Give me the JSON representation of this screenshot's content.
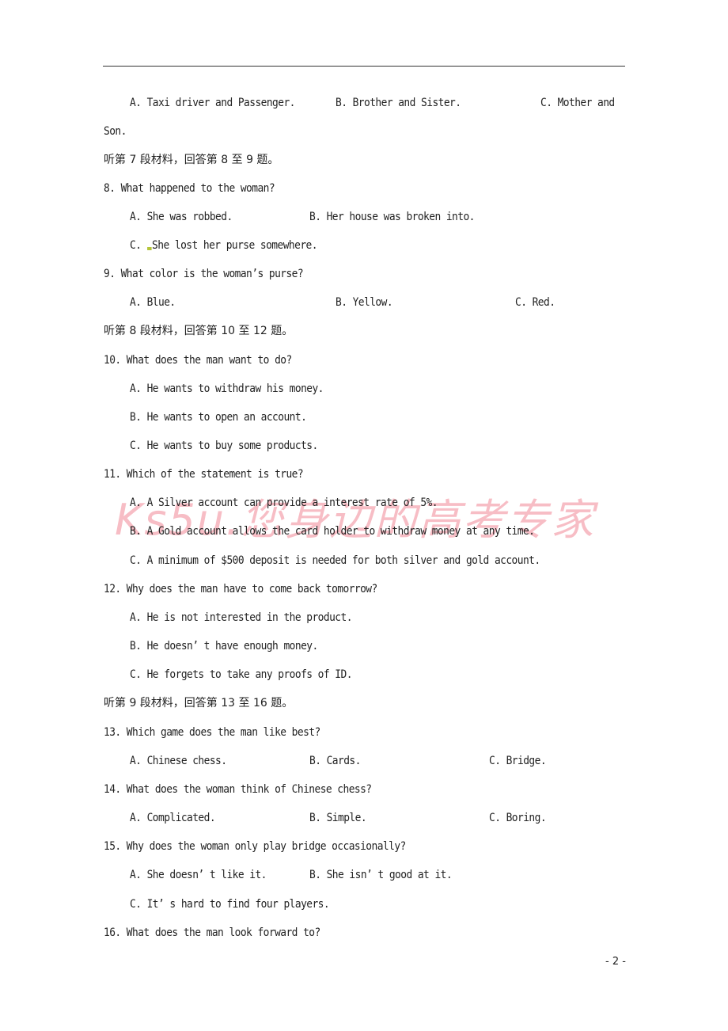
{
  "prev_options": {
    "a": "A. Taxi driver and Passenger.",
    "b": "B. Brother and Sister.",
    "c": "C. Mother and",
    "c_cont": "Son."
  },
  "section7": {
    "heading": "听第 7 段材料，回答第 8 至 9 题。",
    "q8": {
      "question": "8. What happened to the woman?",
      "a": "A. She was robbed.",
      "b": "B. Her house was broken into.",
      "c_label": "C. ",
      "c_text": "She lost her purse somewhere."
    },
    "q9": {
      "question": "9. What color is the woman’s purse?",
      "a": "A. Blue.",
      "b": "B. Yellow.",
      "c": "C. Red."
    }
  },
  "section8": {
    "heading": "听第 8 段材料，回答第 10 至 12 题。",
    "q10": {
      "question": "10. What does the man want to do?",
      "a": "A. He wants to withdraw his money.",
      "b": "B. He wants to open an account.",
      "c": "C. He wants to buy some products."
    },
    "q11": {
      "question": "11. Which of the statement is true?",
      "a": "A. A Silver account can provide a interest rate of 5%.",
      "b": "B. A Gold account allows the card holder to withdraw money at any time.",
      "c": "C. A minimum of $500 deposit is needed for both silver and gold account."
    },
    "q12": {
      "question": "12. Why does the man have to come back tomorrow?",
      "a": "A. He is not interested in the product.",
      "b": "B. He doesn’ t have enough money.",
      "c": "C. He forgets to take any proofs of ID."
    }
  },
  "section9": {
    "heading": "听第 9 段材料，回答第 13 至 16 题。",
    "q13": {
      "question": "13. Which game does the man like best?",
      "a": "A. Chinese chess.",
      "b": "B. Cards.",
      "c": "C. Bridge."
    },
    "q14": {
      "question": "14. What does the woman think of Chinese chess?",
      "a": "A. Complicated.",
      "b": "B. Simple.",
      "c": "C. Boring."
    },
    "q15": {
      "question": "15. Why does the woman only play bridge occasionally?",
      "a": "A. She doesn’ t like it.",
      "b": "B. She isn’ t good at it.",
      "c": "C. It’ s hard to find four players."
    },
    "q16": {
      "question": "16. What does the man look forward to?"
    }
  },
  "watermark": "Ks5u.您身边的高考专家",
  "page_number": "- 2 -"
}
